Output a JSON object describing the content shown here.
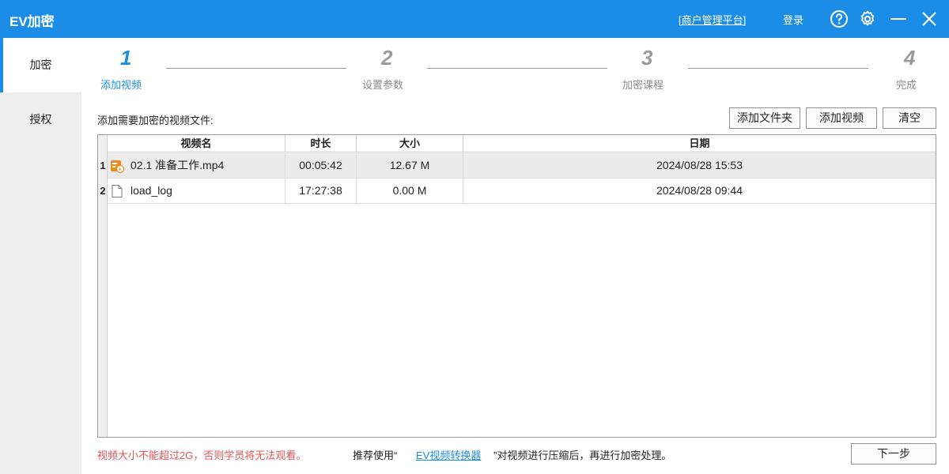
{
  "app": {
    "title": "EV加密"
  },
  "titlebar": {
    "merchant_link": "[商户管理平台]",
    "login": "登录"
  },
  "sidebar": {
    "items": [
      {
        "label": "加密",
        "active": true
      },
      {
        "label": "授权",
        "active": false
      }
    ]
  },
  "steps": [
    {
      "num": "1",
      "label": "添加视频",
      "active": true
    },
    {
      "num": "2",
      "label": "设置参数",
      "active": false
    },
    {
      "num": "3",
      "label": "加密课程",
      "active": false
    },
    {
      "num": "4",
      "label": "完成",
      "active": false
    }
  ],
  "toolbar": {
    "instruction": "添加需要加密的视频文件:",
    "add_folder": "添加文件夹",
    "add_video": "添加视频",
    "clear": "清空"
  },
  "table": {
    "columns": [
      "视频名",
      "时长",
      "大小",
      "日期"
    ],
    "rows": [
      {
        "index": "1",
        "name": "02.1 准备工作.mp4",
        "duration": "00:05:42",
        "size": "12.67 M",
        "date": "2024/08/28 15:53",
        "icon": "video-file-icon"
      },
      {
        "index": "2",
        "name": "load_log",
        "duration": "17:27:38",
        "size": "0.00 M",
        "date": "2024/08/28 09:44",
        "icon": "generic-file-icon"
      }
    ]
  },
  "footer": {
    "warning": "视频大小不能超过2G，否则学员将无法观看。",
    "recommend_prefix": "推荐使用“",
    "converter_link": "EV视频转换器",
    "recommend_suffix": "”对视频进行压缩后，再进行加密处理。",
    "next": "下一步"
  },
  "colors": {
    "accent": "#1b8de6",
    "warning": "#e05555",
    "sidebar_bg": "#eeeeee"
  }
}
